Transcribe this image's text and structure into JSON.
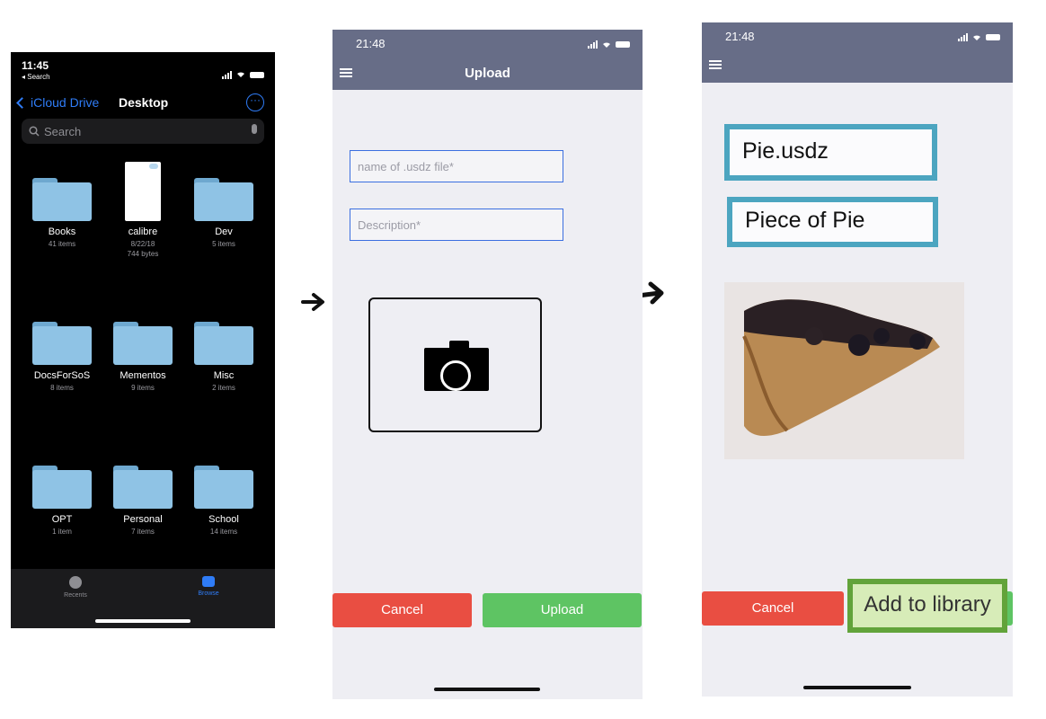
{
  "files_screen": {
    "time": "11:45",
    "back_app": "◂ Search",
    "back_label": "iCloud Drive",
    "title": "Desktop",
    "more_icon": "···",
    "search_placeholder": "Search",
    "items": [
      {
        "name": "Books",
        "meta": "41 items",
        "kind": "folder"
      },
      {
        "name": "calibre",
        "meta": "8/22/18",
        "meta2": "744 bytes",
        "kind": "document"
      },
      {
        "name": "Dev",
        "meta": "5 items",
        "kind": "folder"
      },
      {
        "name": "DocsForSoS",
        "meta": "8 items",
        "kind": "folder"
      },
      {
        "name": "Mementos",
        "meta": "9 items",
        "kind": "folder"
      },
      {
        "name": "Misc",
        "meta": "2 items",
        "kind": "folder"
      },
      {
        "name": "OPT",
        "meta": "1 item",
        "kind": "folder"
      },
      {
        "name": "Personal",
        "meta": "7 items",
        "kind": "folder"
      },
      {
        "name": "School",
        "meta": "14 items",
        "kind": "folder"
      }
    ],
    "tabs": [
      {
        "label": "Recents",
        "icon": "clock-icon"
      },
      {
        "label": "Browse",
        "icon": "folder-icon"
      }
    ]
  },
  "upload_screen": {
    "time": "21:48",
    "title": "Upload",
    "name_placeholder": "name of .usdz file*",
    "description_placeholder": "Description*",
    "camera_icon": "camera-icon",
    "cancel_label": "Cancel",
    "upload_label": "Upload"
  },
  "library_screen": {
    "time": "21:48",
    "file_name": "Pie.usdz",
    "description": "Piece of Pie",
    "photo_icon": "pie-photo",
    "cancel_label": "Cancel",
    "add_label": "Add to library"
  },
  "colors": {
    "accent_blue": "#2f7cf6",
    "header_gray": "#676d87",
    "cancel_red": "#e94e42",
    "upload_green": "#5ec463",
    "highlight_teal": "#4ca5c0",
    "highlight_green": "#62a33a"
  }
}
